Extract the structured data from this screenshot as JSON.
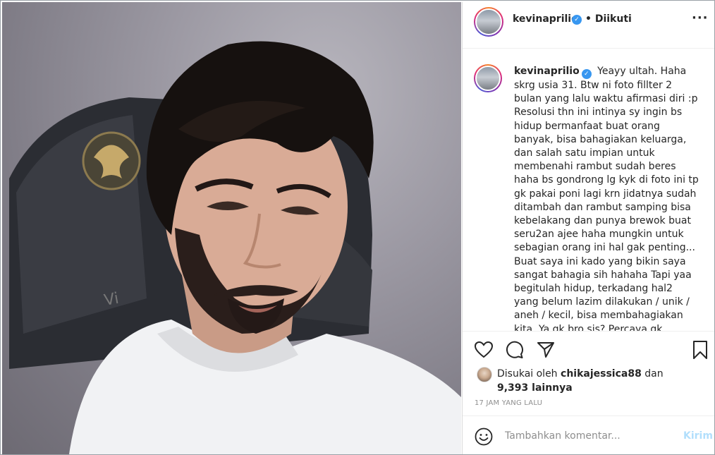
{
  "post": {
    "username": "kevinaprilio",
    "verified_badge": "✓",
    "follow_status": "• Diikuti",
    "more_icon": "more-options-icon",
    "caption": "Yeayy ultah. Haha skrg usia 31. Btw ni foto fillter 2 bulan yang lalu waktu afirmasi diri :p Resolusi thn ini intinya sy ingin bs hidup bermanfaat buat orang banyak, bisa bahagiakan keluarga, dan salah satu impian untuk membenahi rambut sudah beres haha bs gondrong lg kyk di foto ini tp gk pakai poni lagi krn jidatnya sudah ditambah dan rambut samping bisa kebelakang dan punya brewok buat seru2an ajee haha mungkin untuk sebagian orang ini hal gak penting... Buat saya ini kado yang bikin saya sangat bahagia sih hahaha Tapi yaa begitulah hidup, terkadang hal2 yang belum lazim dilakukan / unik / aneh / kecil, bisa membahagiakan kita. Ya gk bro sis? Percaya gk percaya yg dm bnyk bgt ngn transplan 😊😊 yg artis jg ada"
  },
  "likes": {
    "prefix": "Disukai oleh",
    "liker": "chikajessica88",
    "conjunction": "dan",
    "others": "9,393 lainnya"
  },
  "timestamp": "17 JAM YANG LALU",
  "comment_box": {
    "placeholder": "Tambahkan komentar...",
    "post_label": "Kirim"
  },
  "colors": {
    "verified": "#3897f0",
    "post_button_disabled": "#b2dffc",
    "muted_text": "#8e8e8e"
  }
}
